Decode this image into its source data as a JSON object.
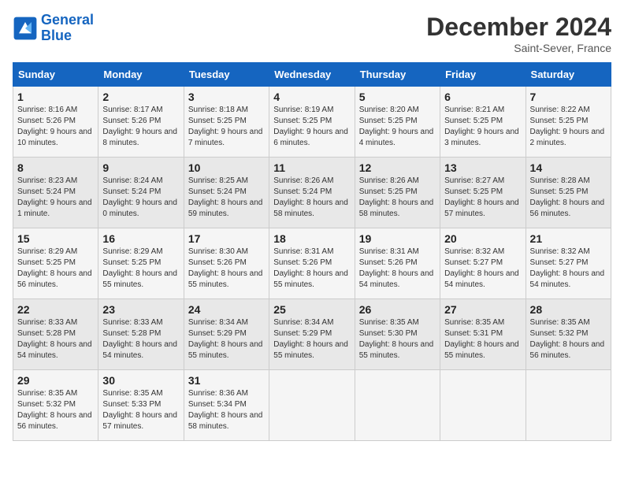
{
  "header": {
    "logo_line1": "General",
    "logo_line2": "Blue",
    "month_year": "December 2024",
    "location": "Saint-Sever, France"
  },
  "days_of_week": [
    "Sunday",
    "Monday",
    "Tuesday",
    "Wednesday",
    "Thursday",
    "Friday",
    "Saturday"
  ],
  "weeks": [
    [
      {
        "day": "1",
        "sunrise": "8:16 AM",
        "sunset": "5:26 PM",
        "daylight": "9 hours and 10 minutes."
      },
      {
        "day": "2",
        "sunrise": "8:17 AM",
        "sunset": "5:26 PM",
        "daylight": "9 hours and 8 minutes."
      },
      {
        "day": "3",
        "sunrise": "8:18 AM",
        "sunset": "5:25 PM",
        "daylight": "9 hours and 7 minutes."
      },
      {
        "day": "4",
        "sunrise": "8:19 AM",
        "sunset": "5:25 PM",
        "daylight": "9 hours and 6 minutes."
      },
      {
        "day": "5",
        "sunrise": "8:20 AM",
        "sunset": "5:25 PM",
        "daylight": "9 hours and 4 minutes."
      },
      {
        "day": "6",
        "sunrise": "8:21 AM",
        "sunset": "5:25 PM",
        "daylight": "9 hours and 3 minutes."
      },
      {
        "day": "7",
        "sunrise": "8:22 AM",
        "sunset": "5:25 PM",
        "daylight": "9 hours and 2 minutes."
      }
    ],
    [
      {
        "day": "8",
        "sunrise": "8:23 AM",
        "sunset": "5:24 PM",
        "daylight": "9 hours and 1 minute."
      },
      {
        "day": "9",
        "sunrise": "8:24 AM",
        "sunset": "5:24 PM",
        "daylight": "9 hours and 0 minutes."
      },
      {
        "day": "10",
        "sunrise": "8:25 AM",
        "sunset": "5:24 PM",
        "daylight": "8 hours and 59 minutes."
      },
      {
        "day": "11",
        "sunrise": "8:26 AM",
        "sunset": "5:24 PM",
        "daylight": "8 hours and 58 minutes."
      },
      {
        "day": "12",
        "sunrise": "8:26 AM",
        "sunset": "5:25 PM",
        "daylight": "8 hours and 58 minutes."
      },
      {
        "day": "13",
        "sunrise": "8:27 AM",
        "sunset": "5:25 PM",
        "daylight": "8 hours and 57 minutes."
      },
      {
        "day": "14",
        "sunrise": "8:28 AM",
        "sunset": "5:25 PM",
        "daylight": "8 hours and 56 minutes."
      }
    ],
    [
      {
        "day": "15",
        "sunrise": "8:29 AM",
        "sunset": "5:25 PM",
        "daylight": "8 hours and 56 minutes."
      },
      {
        "day": "16",
        "sunrise": "8:29 AM",
        "sunset": "5:25 PM",
        "daylight": "8 hours and 55 minutes."
      },
      {
        "day": "17",
        "sunrise": "8:30 AM",
        "sunset": "5:26 PM",
        "daylight": "8 hours and 55 minutes."
      },
      {
        "day": "18",
        "sunrise": "8:31 AM",
        "sunset": "5:26 PM",
        "daylight": "8 hours and 55 minutes."
      },
      {
        "day": "19",
        "sunrise": "8:31 AM",
        "sunset": "5:26 PM",
        "daylight": "8 hours and 54 minutes."
      },
      {
        "day": "20",
        "sunrise": "8:32 AM",
        "sunset": "5:27 PM",
        "daylight": "8 hours and 54 minutes."
      },
      {
        "day": "21",
        "sunrise": "8:32 AM",
        "sunset": "5:27 PM",
        "daylight": "8 hours and 54 minutes."
      }
    ],
    [
      {
        "day": "22",
        "sunrise": "8:33 AM",
        "sunset": "5:28 PM",
        "daylight": "8 hours and 54 minutes."
      },
      {
        "day": "23",
        "sunrise": "8:33 AM",
        "sunset": "5:28 PM",
        "daylight": "8 hours and 54 minutes."
      },
      {
        "day": "24",
        "sunrise": "8:34 AM",
        "sunset": "5:29 PM",
        "daylight": "8 hours and 55 minutes."
      },
      {
        "day": "25",
        "sunrise": "8:34 AM",
        "sunset": "5:29 PM",
        "daylight": "8 hours and 55 minutes."
      },
      {
        "day": "26",
        "sunrise": "8:35 AM",
        "sunset": "5:30 PM",
        "daylight": "8 hours and 55 minutes."
      },
      {
        "day": "27",
        "sunrise": "8:35 AM",
        "sunset": "5:31 PM",
        "daylight": "8 hours and 55 minutes."
      },
      {
        "day": "28",
        "sunrise": "8:35 AM",
        "sunset": "5:32 PM",
        "daylight": "8 hours and 56 minutes."
      }
    ],
    [
      {
        "day": "29",
        "sunrise": "8:35 AM",
        "sunset": "5:32 PM",
        "daylight": "8 hours and 56 minutes."
      },
      {
        "day": "30",
        "sunrise": "8:35 AM",
        "sunset": "5:33 PM",
        "daylight": "8 hours and 57 minutes."
      },
      {
        "day": "31",
        "sunrise": "8:36 AM",
        "sunset": "5:34 PM",
        "daylight": "8 hours and 58 minutes."
      },
      null,
      null,
      null,
      null
    ]
  ]
}
